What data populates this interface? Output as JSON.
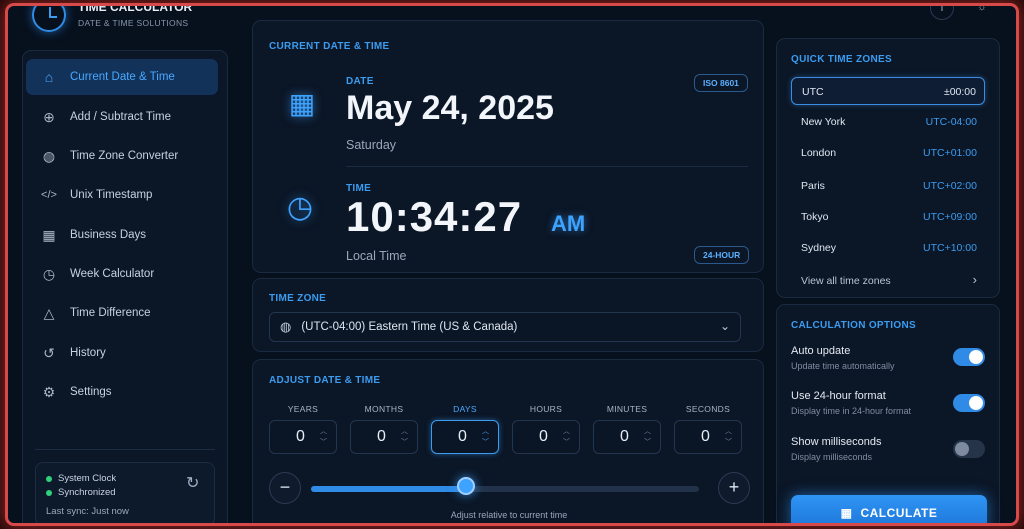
{
  "app": {
    "title": "TIME CALCULATOR",
    "subtitle": "DATE & TIME SOLUTIONS"
  },
  "header": {
    "info_icon": "info-icon",
    "settings_icon": "sun-icon"
  },
  "sidebar": {
    "items": [
      {
        "label": "Current Date & Time",
        "icon": "home-icon",
        "active": true
      },
      {
        "label": "Add / Subtract Time",
        "icon": "plus-circle-icon"
      },
      {
        "label": "Time Zone Converter",
        "icon": "globe-icon"
      },
      {
        "label": "Unix Timestamp",
        "icon": "code-icon"
      },
      {
        "label": "Business Days",
        "icon": "calendar-icon"
      },
      {
        "label": "Week Calculator",
        "icon": "clock-icon"
      },
      {
        "label": "Time Difference",
        "icon": "triangle-icon"
      },
      {
        "label": "History",
        "icon": "history-icon"
      },
      {
        "label": "Settings",
        "icon": "gear-icon"
      }
    ],
    "sync": {
      "line1": "System Clock",
      "line2": "Synchronized",
      "last_sync": "Last sync: Just now"
    }
  },
  "current": {
    "section_label": "CURRENT DATE & TIME",
    "date_label": "DATE",
    "date_value": "May 24, 2025",
    "weekday": "Saturday",
    "date_badge": "ISO 8601",
    "time_label": "TIME",
    "time_value": "10:34:27",
    "ampm": "AM",
    "time_sub": "Local Time",
    "time_badge": "24-HOUR"
  },
  "timezone": {
    "label": "TIME ZONE",
    "selected": "(UTC-04:00) Eastern Time (US & Canada)"
  },
  "adjust": {
    "label": "ADJUST DATE & TIME",
    "fields": [
      {
        "label": "YEARS",
        "value": "0"
      },
      {
        "label": "MONTHS",
        "value": "0"
      },
      {
        "label": "DAYS",
        "value": "0"
      },
      {
        "label": "HOURS",
        "value": "0"
      },
      {
        "label": "MINUTES",
        "value": "0"
      },
      {
        "label": "SECONDS",
        "value": "0"
      }
    ],
    "slider_level": 0.4,
    "hint": "Adjust relative to current time",
    "minus": "−",
    "plus": "+"
  },
  "quick_zones": {
    "label": "QUICK TIME ZONES",
    "zones": [
      {
        "name": "UTC",
        "offset": "±00:00"
      },
      {
        "name": "New York",
        "offset": "UTC-04:00"
      },
      {
        "name": "London",
        "offset": "UTC+01:00"
      },
      {
        "name": "Paris",
        "offset": "UTC+02:00"
      },
      {
        "name": "Tokyo",
        "offset": "UTC+09:00"
      },
      {
        "name": "Sydney",
        "offset": "UTC+10:00"
      }
    ],
    "view_all": "View all time zones"
  },
  "options": {
    "label": "CALCULATION OPTIONS",
    "items": [
      {
        "title": "Auto update",
        "desc": "Update time automatically",
        "on": true
      },
      {
        "title": "Use 24-hour format",
        "desc": "Display time in 24-hour format",
        "on": true
      },
      {
        "title": "Show milliseconds",
        "desc": "Display milliseconds",
        "on": false
      }
    ],
    "button": "CALCULATE"
  }
}
